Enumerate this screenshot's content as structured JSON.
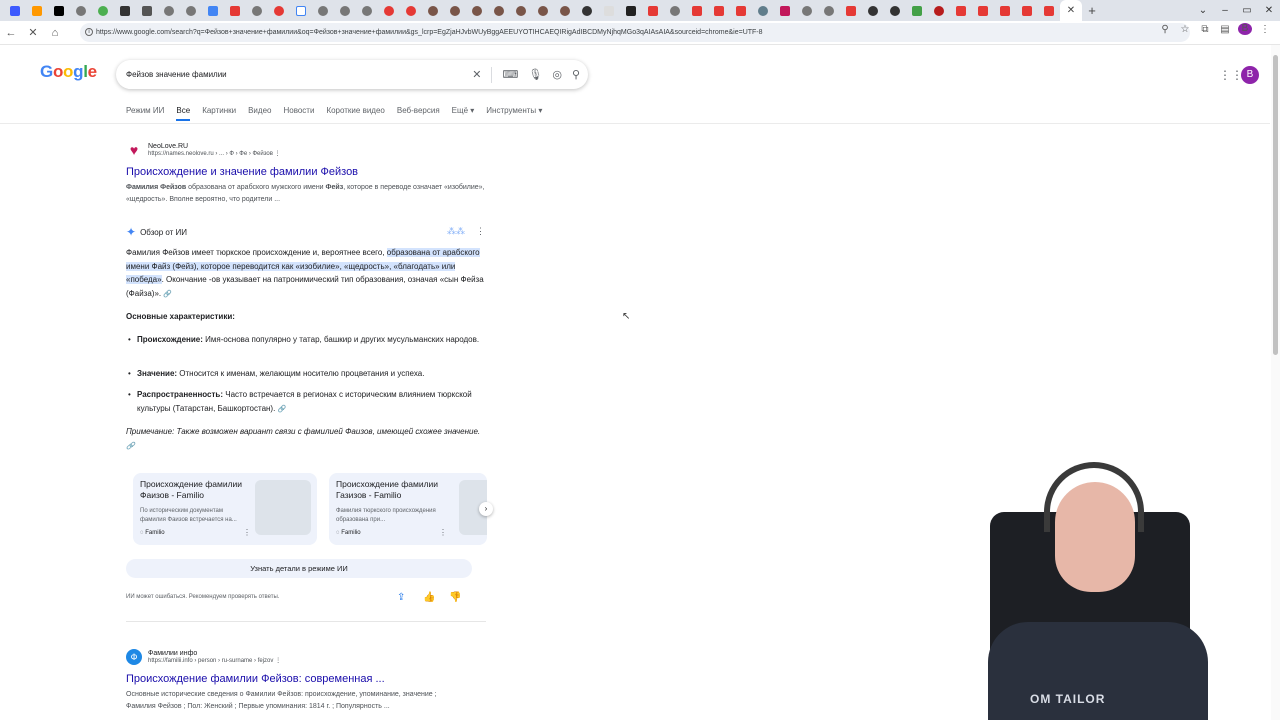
{
  "browser": {
    "url": "https://www.google.com/search?q=Фейзов+значение+фамилии&oq=Фейзов+значение+фамилии&gs_lcrp=EgZjaHJvbWUyBggAEEUYOTIHCAEQIRigAdIBCDMyNjhqMGo3qAIAsAIA&sourceid=chrome&ie=UTF-8",
    "profile_initial": "B"
  },
  "google": {
    "logo": "Google",
    "query": "Фейзов значение фамилии",
    "user_initial": "B",
    "tabs": [
      "Режим ИИ",
      "Все",
      "Картинки",
      "Видео",
      "Новости",
      "Короткие видео",
      "Веб-версия",
      "Ещё ▾",
      "Инструменты ▾"
    ]
  },
  "result1": {
    "site_name": "NeoLove.RU",
    "site_url": "https://names.neolove.ru › ... › Ф › Фе › Фейзов",
    "title": "Происхождение и значение фамилии Фейзов",
    "snippet_bold": "Фамилия Фейзов",
    "snippet_rest": " образована от арабского мужского имени ",
    "snippet_bold2": "Фейз",
    "snippet_rest2": ", которое в переводе означает «изобилие», «щедрость». Вполне вероятно, что родители ..."
  },
  "ai": {
    "header": "Обзор от ИИ",
    "p1_start": "Фамилия Фейзов имеет тюркское происхождение и, вероятнее всего, ",
    "p1_hl": "образована от арабского имени Файз (Фейз), которое переводится как «изобилие», «щедрость», «благодать» или «победа»",
    "p1_end": ". Окончание -ов указывает на патронимический тип образования, означая «сын Фейза (Файза)».",
    "heading": "Основные характеристики:",
    "bullets": [
      {
        "label": "Происхождение:",
        "text": " Имя-основа популярно у татар, башкир и других мусульманских народов."
      },
      {
        "label": "Значение:",
        "text": " Относится к именам, желающим носителю процветания и успеха."
      },
      {
        "label": "Распространенность:",
        "text": " Часто встречается в регионах с историческим влиянием тюркской культуры (Татарстан, Башкортостан)."
      }
    ],
    "note": "Примечание: Также возможен вариант связи с фамилией Фаизов, имеющей схожее значение.",
    "cards": [
      {
        "title": "Происхождение фамилии Фаизов - Familio",
        "desc": "По историческим документам фамилия Фаизов встречается на...",
        "source": "Familio"
      },
      {
        "title": "Происхождение фамилии Газизов - Familio",
        "desc": "Фамилия тюркского происхождения образована при...",
        "source": "Familio"
      }
    ],
    "aimode_button": "Узнать детали в режиме ИИ",
    "disclaimer": "ИИ может ошибаться. Рекомендуем проверять ответы."
  },
  "result2": {
    "site_name": "Фамилии инфо",
    "site_url": "https://familii.info › person › ru-surname › fejzov",
    "title": "Происхождение фамилии Фейзов: современная ...",
    "snippet_line1": "Основные исторические сведения о Фамилии Фейзов: происхождение, упоминание, значение ;",
    "snippet_line2": "Фамилия Фейзов ; Пол: Женский ; Первые упоминания: 1814 г. ; Популярность ..."
  },
  "webcam": {
    "shirt_text": "ОМ TAILOR"
  },
  "colors": {
    "link": "#1a0dab",
    "accent": "#1a73e8",
    "highlight": "#d3e3fd",
    "avatar": "#8e24aa"
  }
}
